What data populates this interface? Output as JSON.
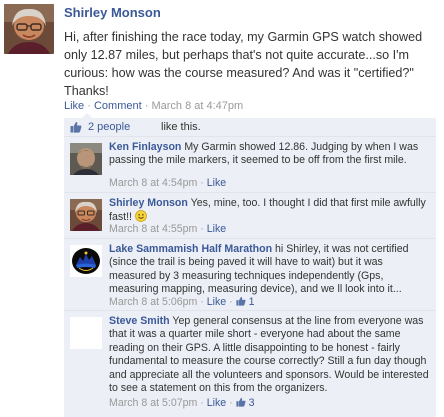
{
  "post": {
    "author": "Shirley Monson",
    "body": "Hi, after finishing the race today, my Garmin GPS watch showed only 12.87 miles, but perhaps that's not quite accurate...so I'm curious: how was the course measured? And was it \"certified?\" Thanks!",
    "actions": {
      "like": "Like",
      "comment": "Comment",
      "separator": "·",
      "timestamp": "March 8 at 4:47pm"
    }
  },
  "likes": {
    "count_link": "2 people",
    "suffix": "like this."
  },
  "comments": [
    {
      "author": "Ken Finlayson",
      "text": "My Garmin showed 12.86. Judging by when I was passing the mile markers, it seemed to be off from the first mile.",
      "timestamp": "March 8 at 4:54pm",
      "like": "Like",
      "like_count": ""
    },
    {
      "author": "Shirley Monson",
      "text": "Yes, mine, too. I thought I did that first mile awfully fast!!",
      "timestamp": "March 8 at 4:55pm",
      "like": "Like",
      "like_count": ""
    },
    {
      "author": "Lake Sammamish Half Marathon",
      "text": "hi Shirley, it was not certified (since the trail is being paved it will have to wait) but it was measured by 3 measuring techniques independently (Gps, measuring mapping, measuring device), and we ll look into it...",
      "timestamp": "March 8 at 5:06pm",
      "like": "Like",
      "like_count": "1"
    },
    {
      "author": "Steve Smith",
      "text": "Yep general consensus at the line from everyone was that it was a quarter mile short - everyone had about the same reading on their GPS. A little disappointing to be honest - fairly fundamental to measure the course correctly? Still a fun day though and appreciate all the volunteers and sponsors. Would be interested to see a statement on this from the organizers.",
      "timestamp": "March 8 at 5:07pm",
      "like": "Like",
      "like_count": "3"
    }
  ],
  "colors": {
    "link": "#3b5998",
    "meta": "#999999",
    "comment_bg": "#eceff5",
    "text": "#333333"
  }
}
